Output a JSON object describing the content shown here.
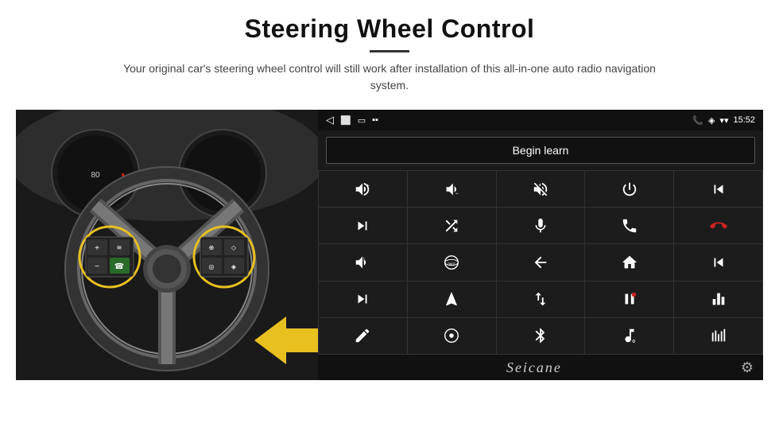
{
  "page": {
    "title": "Steering Wheel Control",
    "subtitle": "Your original car's steering wheel control will still work after installation of this all-in-one auto radio navigation system.",
    "divider": true
  },
  "status_bar": {
    "phone_icon": "📞",
    "location_icon": "◈",
    "wifi_icon": "▾",
    "time": "15:52",
    "nav_back": "◁",
    "nav_home": "⬜",
    "nav_recent": "▭",
    "media_icon": "▪▪"
  },
  "begin_learn": {
    "label": "Begin learn"
  },
  "brand": {
    "name": "Seicane"
  },
  "controls": [
    {
      "id": "vol-up",
      "symbol": "vol_up"
    },
    {
      "id": "vol-down",
      "symbol": "vol_down"
    },
    {
      "id": "mute",
      "symbol": "mute"
    },
    {
      "id": "power",
      "symbol": "power"
    },
    {
      "id": "prev-track",
      "symbol": "prev_track"
    },
    {
      "id": "next-track",
      "symbol": "next_track"
    },
    {
      "id": "shuffle",
      "symbol": "shuffle"
    },
    {
      "id": "mic",
      "symbol": "mic"
    },
    {
      "id": "phone",
      "symbol": "phone"
    },
    {
      "id": "hang-up",
      "symbol": "hang_up"
    },
    {
      "id": "horn",
      "symbol": "horn"
    },
    {
      "id": "view360",
      "symbol": "view360"
    },
    {
      "id": "back",
      "symbol": "back"
    },
    {
      "id": "home",
      "symbol": "home"
    },
    {
      "id": "prev-chapter",
      "symbol": "prev_chapter"
    },
    {
      "id": "fast-forward",
      "symbol": "fast_forward"
    },
    {
      "id": "navigate",
      "symbol": "navigate"
    },
    {
      "id": "swap",
      "symbol": "swap"
    },
    {
      "id": "record",
      "symbol": "record"
    },
    {
      "id": "equalizer",
      "symbol": "equalizer"
    },
    {
      "id": "pencil",
      "symbol": "pencil"
    },
    {
      "id": "360-view2",
      "symbol": "circle_dot"
    },
    {
      "id": "bluetooth",
      "symbol": "bluetooth"
    },
    {
      "id": "music",
      "symbol": "music"
    },
    {
      "id": "audio-levels",
      "symbol": "audio_levels"
    }
  ]
}
